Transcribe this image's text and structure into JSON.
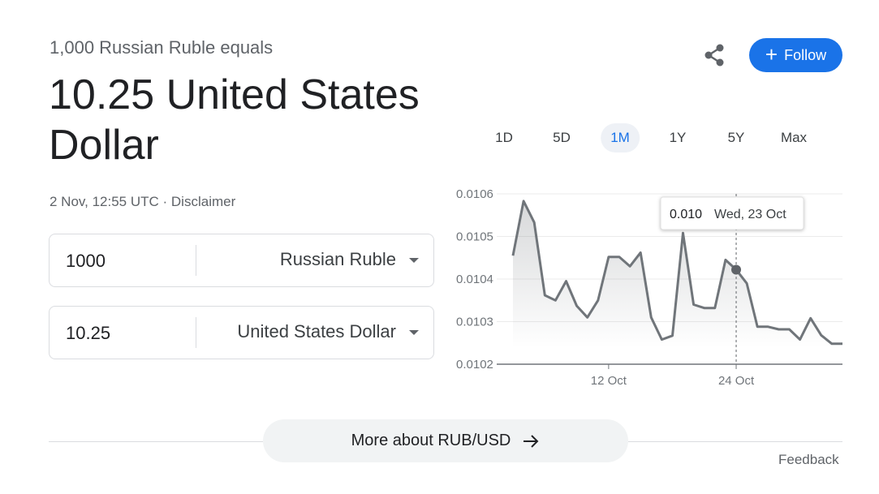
{
  "header": {
    "subtitle": "1,000 Russian Ruble equals",
    "result": "10.25 United States Dollar",
    "timestamp": "2 Nov, 12:55 UTC",
    "separator": " · ",
    "disclaimer": "Disclaimer"
  },
  "actions": {
    "share_icon": "share-icon",
    "follow_label": "Follow"
  },
  "converter": {
    "from": {
      "value": "1000",
      "currency": "Russian Ruble"
    },
    "to": {
      "value": "10.25",
      "currency": "United States Dollar"
    }
  },
  "ranges": {
    "items": [
      "1D",
      "5D",
      "1M",
      "1Y",
      "5Y",
      "Max"
    ],
    "selected": "1M"
  },
  "chart_data": {
    "type": "line",
    "ylim": [
      0.0102,
      0.0106
    ],
    "yticks": [
      "0.0106",
      "0.0105",
      "0.0104",
      "0.0103",
      "0.0102"
    ],
    "xtick_labels": [
      {
        "index": 9,
        "label": "12 Oct"
      },
      {
        "index": 21,
        "label": "24 Oct"
      }
    ],
    "values": [
      0.010455,
      0.010583,
      0.010533,
      0.010362,
      0.01035,
      0.010395,
      0.010337,
      0.01031,
      0.01035,
      0.010452,
      0.010452,
      0.01043,
      0.010462,
      0.01031,
      0.010258,
      0.010267,
      0.010508,
      0.01034,
      0.010332,
      0.010332,
      0.010445,
      0.010422,
      0.01039,
      0.010288,
      0.010288,
      0.010282,
      0.010282,
      0.010258,
      0.010308,
      0.010268,
      0.010248,
      0.010248
    ],
    "tooltip": {
      "index": 21,
      "value": "0.010",
      "date": "Wed, 23 Oct"
    },
    "line_color": "#70757a",
    "grid": true
  },
  "footer": {
    "more_label": "More about RUB/USD",
    "feedback": "Feedback"
  }
}
